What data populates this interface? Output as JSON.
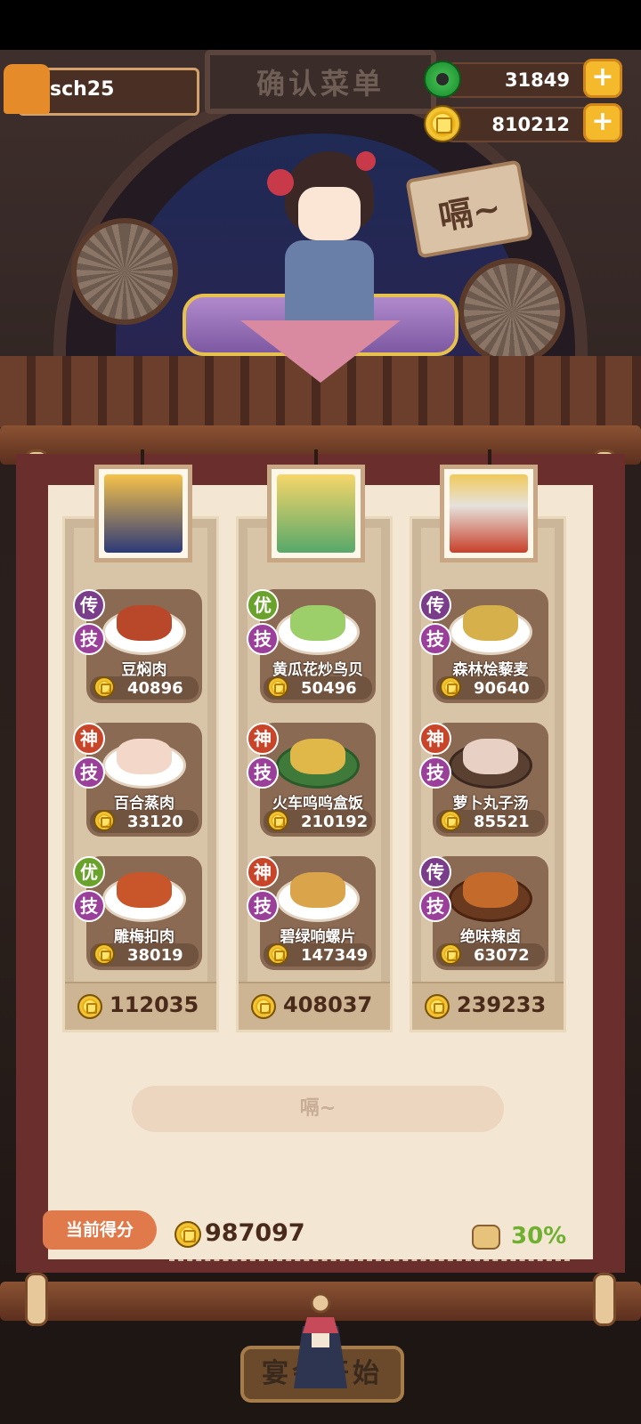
{
  "header": {
    "board_title": "确认菜单",
    "player_name": "sch25",
    "jade": "31849",
    "coins": "810212",
    "plus": "+"
  },
  "speech_bubble": "嗝~",
  "columns": [
    {
      "total": "112035",
      "dishes": [
        {
          "badge1": "传",
          "badge2": "技",
          "name": "豆焖肉",
          "price": "40896"
        },
        {
          "badge1": "神",
          "badge2": "技",
          "name": "百合蒸肉",
          "price": "33120"
        },
        {
          "badge1": "优",
          "badge2": "技",
          "name": "雕梅扣肉",
          "price": "38019"
        }
      ]
    },
    {
      "total": "408037",
      "dishes": [
        {
          "badge1": "优",
          "badge2": "技",
          "name": "黄瓜花炒鸟贝",
          "price": "50496"
        },
        {
          "badge1": "神",
          "badge2": "技",
          "name": "火车呜呜盒饭",
          "price": "210192"
        },
        {
          "badge1": "神",
          "badge2": "技",
          "name": "碧绿响螺片",
          "price": "147349"
        }
      ]
    },
    {
      "total": "239233",
      "dishes": [
        {
          "badge1": "传",
          "badge2": "技",
          "name": "森林烩藜麦",
          "price": "90640"
        },
        {
          "badge1": "神",
          "badge2": "技",
          "name": "萝卜丸子汤",
          "price": "85521"
        },
        {
          "badge1": "传",
          "badge2": "技",
          "name": "绝味辣卤",
          "price": "63072"
        }
      ]
    }
  ],
  "feast_button": "嗝~",
  "score": {
    "label": "当前得分",
    "value": "987097",
    "bonus": "30%"
  },
  "start_button": "宴会开始",
  "colors": {
    "frame": "#6a2f2c",
    "paper": "#f3e7d4",
    "accent_orange": "#e07a4a",
    "bonus_green": "#6fb030",
    "plus_yellow": "#f5b92c"
  }
}
